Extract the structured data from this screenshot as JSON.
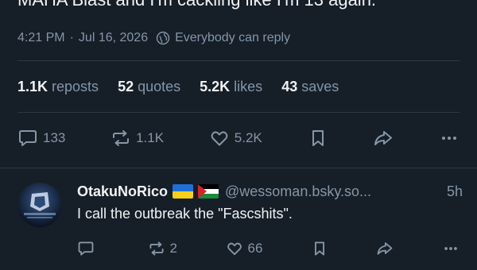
{
  "post": {
    "text_tail": "MAHA Blast and I'm cackling like I'm 13 again.",
    "time": "4:21 PM",
    "separator": "·",
    "date": "Jul 16, 2026",
    "reply_setting": "Everybody can reply",
    "stats": {
      "reposts_count": "1.1K",
      "reposts_label": "reposts",
      "quotes_count": "52",
      "quotes_label": "quotes",
      "likes_count": "5.2K",
      "likes_label": "likes",
      "saves_count": "43",
      "saves_label": "saves"
    },
    "actions": {
      "reply_count": "133",
      "repost_count": "1.1K",
      "like_count": "5.2K"
    }
  },
  "reply": {
    "display_name": "OtakuNoRico",
    "flags": [
      "ukraine-flag",
      "palestine-flag"
    ],
    "handle": "@wessoman.bsky.so...",
    "time_ago": "5h",
    "text": "I call the outbreak the \"Fascshits\".",
    "actions": {
      "reply_count": "",
      "repost_count": "2",
      "like_count": "66"
    }
  },
  "colors": {
    "background": "#161e27",
    "text_primary": "#f1f3f5",
    "text_secondary": "#8596a8",
    "divider": "#2e3a47"
  },
  "icons": [
    "globe-icon",
    "reply-icon",
    "repost-icon",
    "heart-icon",
    "bookmark-icon",
    "share-icon",
    "more-icon"
  ]
}
